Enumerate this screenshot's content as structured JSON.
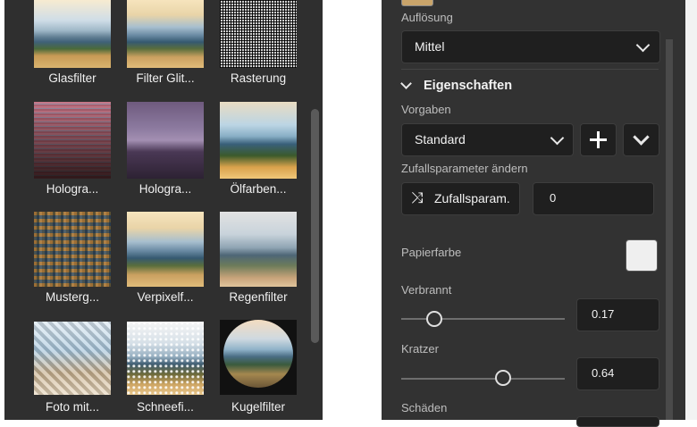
{
  "filters": {
    "items": [
      {
        "label": "Glasfilter"
      },
      {
        "label": "Filter Glit..."
      },
      {
        "label": "Rasterung"
      },
      {
        "label": "Hologra..."
      },
      {
        "label": "Hologra..."
      },
      {
        "label": "Ölfarben..."
      },
      {
        "label": "Musterg..."
      },
      {
        "label": "Verpixelf..."
      },
      {
        "label": "Regenfilter"
      },
      {
        "label": "Foto mit..."
      },
      {
        "label": "Schneefi..."
      },
      {
        "label": "Kugelfilter"
      }
    ]
  },
  "properties": {
    "resolution_label": "Auflösung",
    "resolution_value": "Mittel",
    "section_title": "Eigenschaften",
    "presets_label": "Vorgaben",
    "presets_value": "Standard",
    "random_label": "Zufallsparameter ändern",
    "random_button": "Zufallsparam.",
    "random_value": "0",
    "paper_color_label": "Papierfarbe",
    "paper_color": "#efefef",
    "burned_label": "Verbrannt",
    "burned_value": "0.17",
    "scratches_label": "Kratzer",
    "scratches_value": "0.64",
    "damage_label": "Schäden"
  }
}
